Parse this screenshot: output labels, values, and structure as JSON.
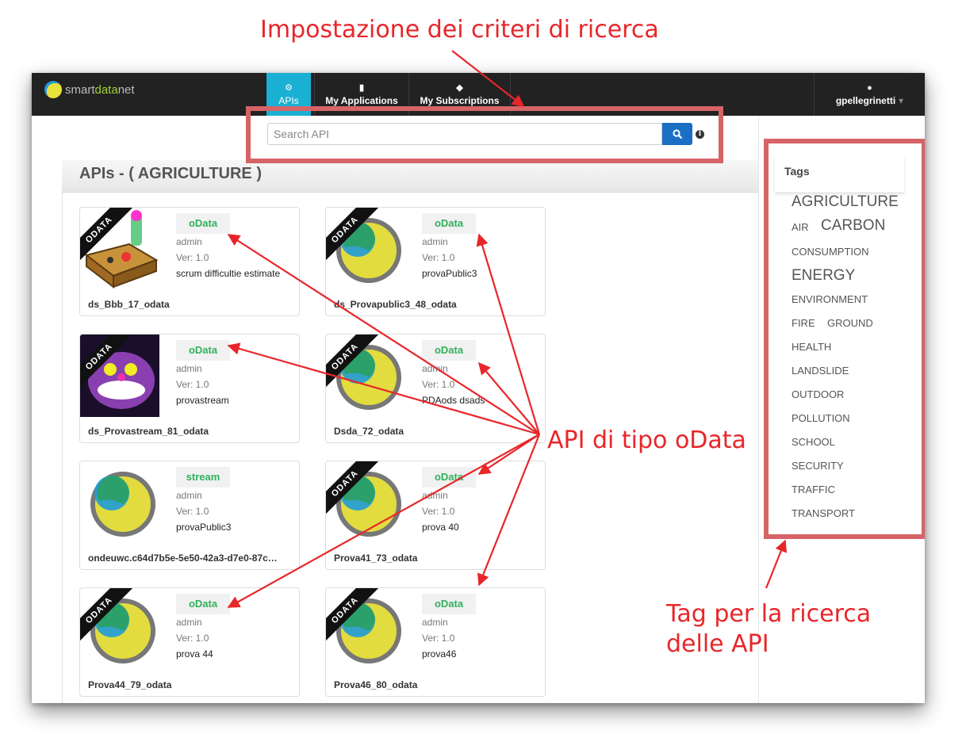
{
  "annotations": {
    "search_criteria": "Impostazione dei criteri di ricerca",
    "odata_api": "API di tipo oData",
    "tags_line1": "Tag per la ricerca",
    "tags_line2": "delle API"
  },
  "brand": {
    "prefix": "smart",
    "highlight": "data",
    "suffix": "net"
  },
  "nav": {
    "apis": "APIs",
    "my_applications": "My Applications",
    "my_subscriptions": "My Subscriptions",
    "user": "gpellegrinetti"
  },
  "search": {
    "placeholder": "Search API",
    "info": "i"
  },
  "panel_title": "APIs - ( AGRICULTURE )",
  "cards": [
    {
      "type": "oData",
      "owner": "admin",
      "version": "Ver: 1.0",
      "description": "scrum difficultie estimate",
      "name": "ds_Bbb_17_odata",
      "ribbon": "ODATA"
    },
    {
      "type": "oData",
      "owner": "admin",
      "version": "Ver: 1.0",
      "description": "provaPublic3",
      "name": "ds_Provapublic3_48_odata",
      "ribbon": "ODATA"
    },
    {
      "type": "oData",
      "owner": "admin",
      "version": "Ver: 1.0",
      "description": "provastream",
      "name": "ds_Provastream_81_odata",
      "ribbon": "ODATA"
    },
    {
      "type": "oData",
      "owner": "admin",
      "version": "Ver: 1.0",
      "description": "PDAods dsads",
      "name": "Dsda_72_odata",
      "ribbon": "ODATA"
    },
    {
      "type": "stream",
      "owner": "admin",
      "version": "Ver: 1.0",
      "description": "provaPublic3",
      "name": "ondeuwc.c64d7b5e-5e50-42a3-d7e0-87c…",
      "ribbon": ""
    },
    {
      "type": "oData",
      "owner": "admin",
      "version": "Ver: 1.0",
      "description": "prova 40",
      "name": "Prova41_73_odata",
      "ribbon": "ODATA"
    },
    {
      "type": "oData",
      "owner": "admin",
      "version": "Ver: 1.0",
      "description": "prova 44",
      "name": "Prova44_79_odata",
      "ribbon": "ODATA"
    },
    {
      "type": "oData",
      "owner": "admin",
      "version": "Ver: 1.0",
      "description": "prova46",
      "name": "Prova46_80_odata",
      "ribbon": "ODATA"
    }
  ],
  "tags": {
    "title": "Tags",
    "items": [
      "AGRICULTURE",
      "AIR",
      "CARBON",
      "CONSUMPTION",
      "ENERGY",
      "ENVIRONMENT",
      "FIRE",
      "GROUND",
      "HEALTH",
      "LANDSLIDE",
      "OUTDOOR",
      "POLLUTION",
      "SCHOOL",
      "SECURITY",
      "TRAFFIC",
      "TRANSPORT"
    ]
  },
  "colors": {
    "annotation_red": "#e8262a",
    "highlight_box": "#d66466",
    "nav_active": "#1ab0d3",
    "search_button": "#1a6fc4",
    "badge_text": "#31b15a"
  },
  "icons": {
    "search_button": "search-icon",
    "user": "user-icon",
    "apis": "cogs-icon",
    "applications": "briefcase-icon",
    "subscriptions": "tags-icon"
  }
}
